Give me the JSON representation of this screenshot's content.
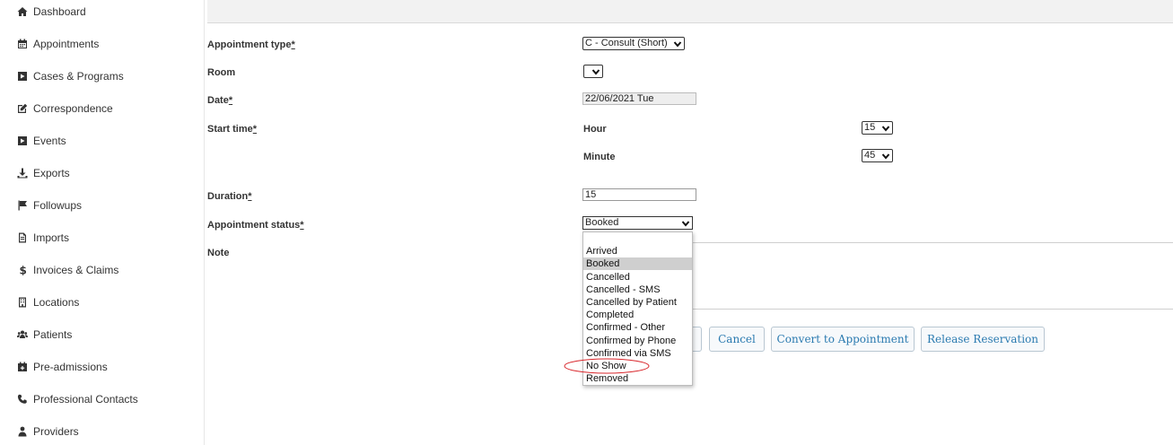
{
  "sidebar": {
    "items": [
      {
        "label": "Dashboard",
        "icon": "home-icon"
      },
      {
        "label": "Appointments",
        "icon": "calendar-icon"
      },
      {
        "label": "Cases & Programs",
        "icon": "play-square-icon"
      },
      {
        "label": "Correspondence",
        "icon": "edit-icon"
      },
      {
        "label": "Events",
        "icon": "play-square-icon"
      },
      {
        "label": "Exports",
        "icon": "download-icon"
      },
      {
        "label": "Followups",
        "icon": "flag-icon"
      },
      {
        "label": "Imports",
        "icon": "file-icon"
      },
      {
        "label": "Invoices & Claims",
        "icon": "dollar-icon"
      },
      {
        "label": "Locations",
        "icon": "building-icon"
      },
      {
        "label": "Patients",
        "icon": "users-icon"
      },
      {
        "label": "Pre-admissions",
        "icon": "calendar-plus-icon"
      },
      {
        "label": "Professional Contacts",
        "icon": "phone-icon"
      },
      {
        "label": "Providers",
        "icon": "user-md-icon"
      }
    ]
  },
  "form": {
    "appointment_type": {
      "label": "Appointment type",
      "required": "*",
      "value": "C - Consult (Short)"
    },
    "room": {
      "label": "Room",
      "value": ""
    },
    "date": {
      "label": "Date",
      "required": "*",
      "value": "22/06/2021 Tue"
    },
    "start_time": {
      "label": "Start time",
      "required": "*",
      "hour": {
        "label": "Hour",
        "value": "15"
      },
      "minute": {
        "label": "Minute",
        "value": "45"
      }
    },
    "duration": {
      "label": "Duration",
      "required": "*",
      "value": "15"
    },
    "appointment_status": {
      "label": "Appointment status",
      "required": "*",
      "value": "Booked",
      "options": [
        "",
        "Arrived",
        "Booked",
        "Cancelled",
        "Cancelled - SMS",
        "Cancelled by Patient",
        "Completed",
        "Confirmed - Other",
        "Confirmed by Phone",
        "Confirmed via SMS",
        "No Show",
        "Removed"
      ],
      "highlighted": "Booked"
    },
    "note": {
      "label": "Note"
    }
  },
  "buttons": {
    "cancel": "Cancel",
    "convert": "Convert to Appointment",
    "release": "Release Reservation"
  },
  "colors": {
    "annotation_circle": "#d9262b",
    "button_text": "#2a7ab0"
  }
}
